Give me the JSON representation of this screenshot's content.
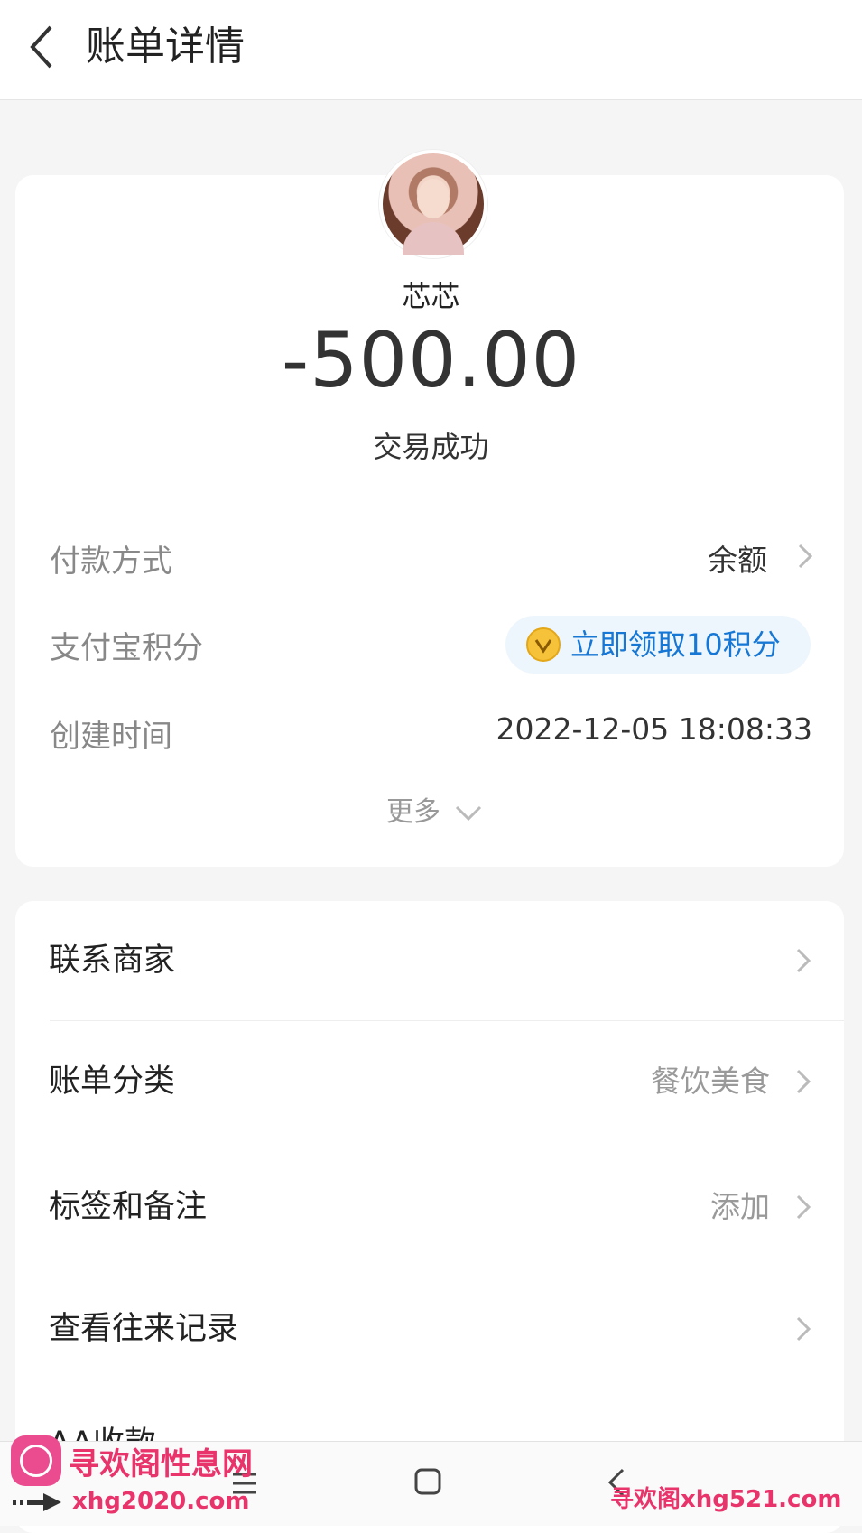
{
  "header": {
    "title": "账单详情"
  },
  "summary": {
    "merchant_name": "芯芯",
    "amount": "-500.00",
    "status": "交易成功"
  },
  "details": {
    "payment_method_label": "付款方式",
    "payment_method_value": "余额",
    "points_label": "支付宝积分",
    "points_action": "立即领取10积分",
    "created_time_label": "创建时间",
    "created_time_value": "2022-12-05 18:08:33",
    "more_label": "更多"
  },
  "actions": [
    {
      "label": "联系商家",
      "value": ""
    },
    {
      "label": "账单分类",
      "value": "餐饮美食"
    },
    {
      "label": "标签和备注",
      "value": "添加"
    },
    {
      "label": "查看往来记录",
      "value": ""
    },
    {
      "label": "AA收款",
      "value": ""
    }
  ],
  "watermarks": {
    "left_title": "寻欢阁性息网",
    "left_url": "xhg2020.com",
    "right_text": "寻欢阁xhg521.com"
  },
  "colors": {
    "accent_blue": "#1677d4",
    "points_bg": "#eef6fd",
    "watermark_pink": "#e8336b"
  },
  "icons": [
    "back-arrow-icon",
    "chevron-right-icon",
    "points-coin-icon",
    "chevron-down-icon",
    "nav-menu-icon",
    "nav-home-icon",
    "nav-back-icon"
  ]
}
